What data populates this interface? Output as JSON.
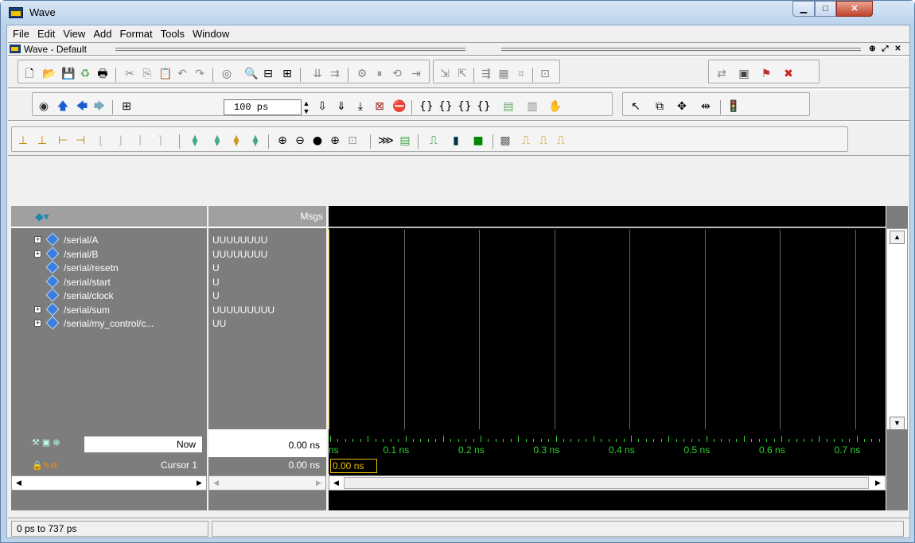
{
  "window": {
    "title": "Wave"
  },
  "menu": [
    "File",
    "Edit",
    "View",
    "Add",
    "Format",
    "Tools",
    "Window"
  ],
  "panel": {
    "title": "Wave - Default"
  },
  "toolbar": {
    "time_value": "100 ps"
  },
  "signals_header": {
    "msgs": "Msgs"
  },
  "signals": [
    {
      "name": "/serial/A",
      "value": "UUUUUUUU",
      "expandable": true
    },
    {
      "name": "/serial/B",
      "value": "UUUUUUUU",
      "expandable": true
    },
    {
      "name": "/serial/resetn",
      "value": "U",
      "expandable": false
    },
    {
      "name": "/serial/start",
      "value": "U",
      "expandable": false
    },
    {
      "name": "/serial/clock",
      "value": "U",
      "expandable": false
    },
    {
      "name": "/serial/sum",
      "value": "UUUUUUUUU",
      "expandable": true
    },
    {
      "name": "/serial/my_control/c...",
      "value": "UU",
      "expandable": true
    }
  ],
  "now": {
    "label": "Now",
    "value": "0.00 ns"
  },
  "cursor": {
    "label": "Cursor 1",
    "value": "0.00 ns",
    "box": "0.00 ns"
  },
  "ruler": {
    "labels": [
      "ns",
      "0.1 ns",
      "0.2 ns",
      "0.3 ns",
      "0.4 ns",
      "0.5 ns",
      "0.6 ns",
      "0.7 ns"
    ]
  },
  "status": {
    "range": "0 ps to 737 ps"
  },
  "colors": {
    "wave_bg": "#000000",
    "ruler": "#2fd22f",
    "cursor": "#e8c000",
    "signal_icon": "#3d7de0"
  }
}
